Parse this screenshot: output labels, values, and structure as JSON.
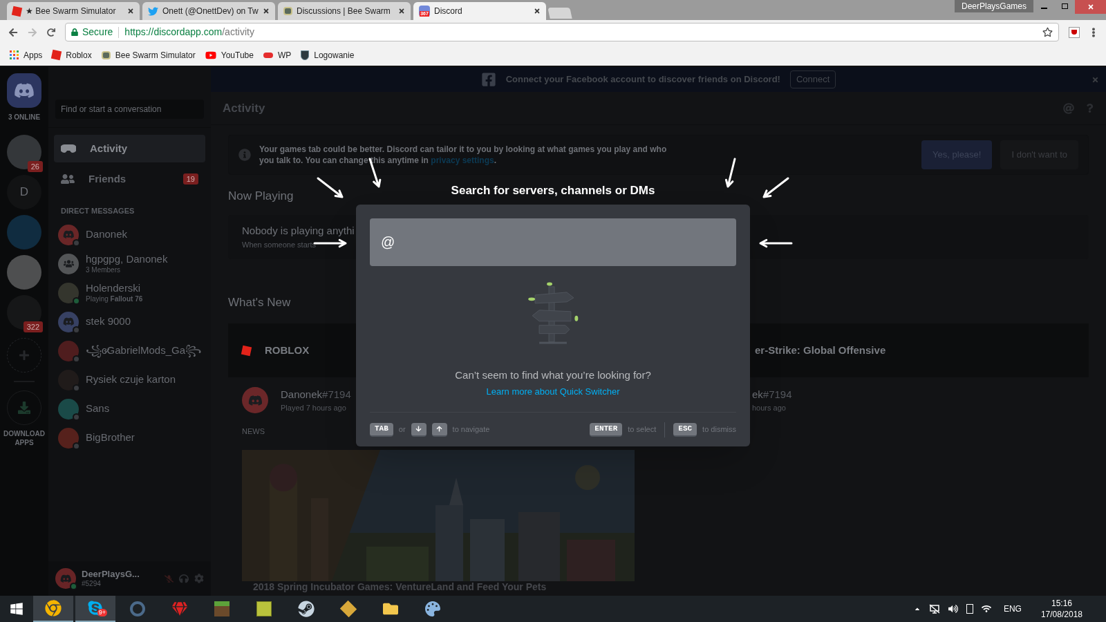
{
  "browser": {
    "tabs": [
      {
        "title": "★ Bee Swarm Simulator",
        "selected": false
      },
      {
        "title": "Onett (@OnettDev) on Tw",
        "selected": false
      },
      {
        "title": "Discussions | Bee Swarm",
        "selected": false
      },
      {
        "title": "Discord",
        "icon_badge": "367",
        "selected": true
      }
    ],
    "profile": "DeerPlaysGames",
    "address": {
      "secure": "Secure",
      "host": "https://discordapp.com",
      "path": "/activity"
    },
    "bookmarks": [
      "Apps",
      "Roblox",
      "Bee Swarm Simulator",
      "YouTube",
      "WP",
      "Logowanie"
    ]
  },
  "discord": {
    "online_count": "3 ONLINE",
    "servers": [
      {
        "kind": "picture",
        "badge": "26"
      },
      {
        "kind": "letter",
        "letter": "D"
      },
      {
        "kind": "picture"
      },
      {
        "kind": "picture"
      },
      {
        "kind": "picture",
        "badge": "322"
      }
    ],
    "download_label": "DOWNLOAD APPS",
    "search_placeholder": "Find or start a conversation",
    "nav": [
      {
        "label": "Activity",
        "selected": true
      },
      {
        "label": "Friends",
        "selected": false,
        "badge": "19"
      }
    ],
    "dm_heading": "DIRECT MESSAGES",
    "dms": [
      {
        "name": "Danonek",
        "kind": "logo",
        "online": false
      },
      {
        "name": "hgpgpg, Danonek",
        "subtitle": "3 Members",
        "kind": "group"
      },
      {
        "name": "Holenderski",
        "subtitle": "Playing **Fallout 76**",
        "kind": "picture",
        "online": true
      },
      {
        "name": "stek 9000",
        "kind": "logo",
        "online": false
      },
      {
        "name": "꧁ɞ̷GabrielMods_Ga꧂",
        "kind": "picture",
        "online": false
      },
      {
        "name": "Rysiek czuje karton",
        "kind": "picture",
        "online": false
      },
      {
        "name": "Sans",
        "kind": "picture",
        "online": false
      },
      {
        "name": "BigBrother",
        "kind": "picture",
        "online": false
      }
    ],
    "user": {
      "name": "DeerPlaysG...",
      "tag": "#5294",
      "online": true
    },
    "banner": {
      "text": "Connect your Facebook account to discover friends on Discord!",
      "button": "Connect"
    },
    "header": "Activity",
    "info": {
      "text": "Your games tab could be better. Discord can tailor it to you by looking at what games you play and who you talk to. You can change this anytime in",
      "link": "privacy settings",
      "after": ".",
      "accept": "Yes, please!",
      "decline": "I don't want to"
    },
    "now_playing": {
      "heading": "Now Playing",
      "text": "Nobody is playing anythi",
      "subtext": "When someone starts"
    },
    "whats_new": {
      "heading": "What's New",
      "games": [
        "ROBLOX",
        "er-Strike: Global Offensive"
      ],
      "activity": [
        {
          "name": "Danonek",
          "tag": "#7194",
          "time": "Played 7 hours ago"
        },
        {
          "name": "ek",
          "tag": "#7194",
          "time": "hours ago"
        }
      ],
      "news_label": "NEWS",
      "news_caption": "2018 Spring Incubator Games: VentureLand and Feed Your Pets"
    }
  },
  "switcher": {
    "title": "Search for servers, channels or DMs",
    "value": "@",
    "empty_text": "Can’t seem to find what you’re looking for?",
    "link": "Learn more about Quick Switcher",
    "hints": [
      {
        "kind": "key",
        "label": "TAB"
      },
      {
        "kind": "text",
        "label": "or"
      },
      {
        "kind": "down-key"
      },
      {
        "kind": "up-key"
      },
      {
        "kind": "text",
        "label": "to navigate"
      },
      {
        "kind": "spacer"
      },
      {
        "kind": "key",
        "label": "ENTER"
      },
      {
        "kind": "text",
        "label": "to select"
      },
      {
        "kind": "divider"
      },
      {
        "kind": "key",
        "label": "ESC"
      },
      {
        "kind": "text",
        "label": "to dismiss"
      }
    ]
  },
  "taskbar": {
    "skype_badge": "9+",
    "tray": {
      "language": "ENG",
      "time": "15:16",
      "date": "17/08/2018"
    }
  }
}
